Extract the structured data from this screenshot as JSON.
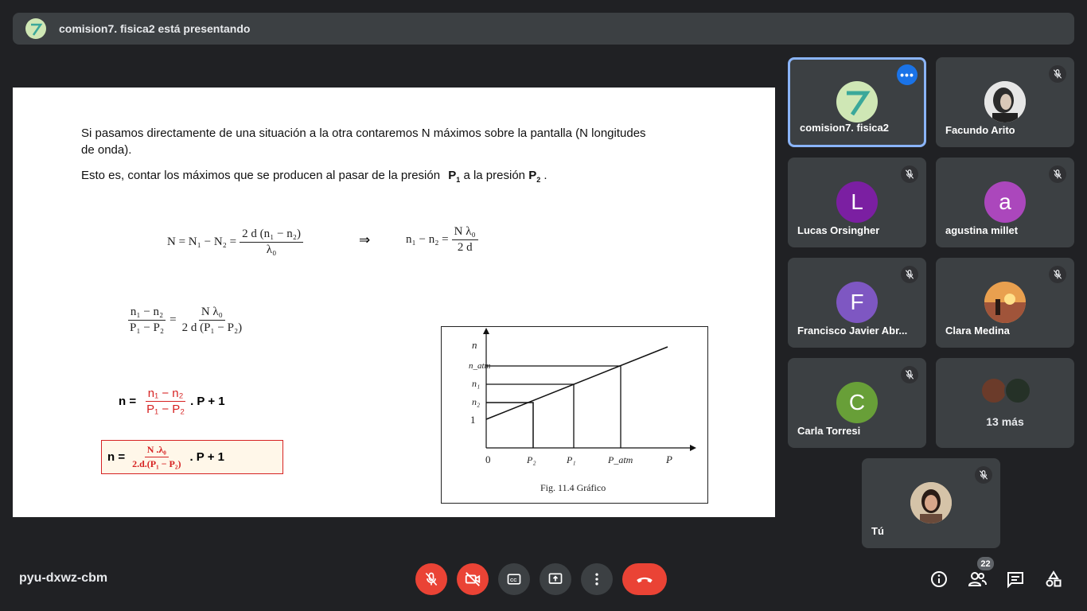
{
  "presentation_bar": {
    "text": "comision7. fisica2 está presentando"
  },
  "slide": {
    "paragraph1": "Si pasamos directamente de una situación a la otra contaremos N máximos sobre la pantalla (N longitudes",
    "paragraph1_cont": "de onda).",
    "paragraph2_a": "Esto es, contar los máximos que se producen al pasar de la presión",
    "paragraph2_p1": "P",
    "paragraph2_p1_sub": "1",
    "paragraph2_b": "a la presión",
    "paragraph2_p2": "P",
    "paragraph2_p2_sub": "2",
    "paragraph2_end": ".",
    "eq1_left": "N = N₁ − N₂ =",
    "eq1_num": "2 d (n₁ − n₂)",
    "eq1_den": "λ₀",
    "implies": "⇒",
    "eq2_left": "n₁ − n₂ =",
    "eq2_num": "N λ₀",
    "eq2_den": "2 d",
    "eq3_lnum": "n₁ − n₂",
    "eq3_lden": "P₁ − P₂",
    "eq3_eq": "=",
    "eq3_rnum": "N λ₀",
    "eq3_rden": "2 d (P₁ − P₂)",
    "eq4_left": "n =",
    "eq4_num": "n₁  −  n₂",
    "eq4_den": "P₁  −  P₂",
    "eq4_right": ". P + 1",
    "eq5_left": "n =",
    "eq5_num": "N .λ₀",
    "eq5_den": "2.d.(P₁  −  P₂)",
    "eq5_right": ". P + 1",
    "graph": {
      "y_axis_label": "n",
      "y_ticks": [
        "n_atm",
        "n₁",
        "n₂",
        "1"
      ],
      "x_ticks": [
        "0",
        "P₂",
        "P₁",
        "P_atm",
        "P"
      ],
      "caption": "Fig. 11.4  Gráfico"
    }
  },
  "participants": [
    {
      "name": "comision7. fisica2",
      "initial": "",
      "color": "#cfe7b5",
      "presenting": true
    },
    {
      "name": "Facundo Arito",
      "initial": "",
      "color": "#eeeeee"
    },
    {
      "name": "Lucas Orsingher",
      "initial": "L",
      "color": "#7b1fa2"
    },
    {
      "name": "agustina millet",
      "initial": "a",
      "color": "#ab47bc"
    },
    {
      "name": "Francisco Javier Abr...",
      "initial": "F",
      "color": "#7e57c2"
    },
    {
      "name": "Clara Medina",
      "initial": "",
      "color": "#e2874a"
    },
    {
      "name": "Carla Torresi",
      "initial": "C",
      "color": "#689f38"
    },
    {
      "name": "13 más",
      "initial": "",
      "color": "#3c4043"
    },
    {
      "name": "Tú",
      "initial": "",
      "color": "#c9b59d"
    }
  ],
  "bottom_bar": {
    "meeting_code": "pyu-dxwz-cbm",
    "participants_count": "22"
  },
  "icons": {
    "mic_off": "mic-off-icon",
    "camera_off": "camera-off-icon",
    "captions": "captions-icon",
    "present": "present-screen-icon",
    "more": "more-vert-icon",
    "leave": "call-end-icon",
    "info": "info-icon",
    "people": "people-icon",
    "chat": "chat-icon",
    "activities": "activities-icon"
  }
}
